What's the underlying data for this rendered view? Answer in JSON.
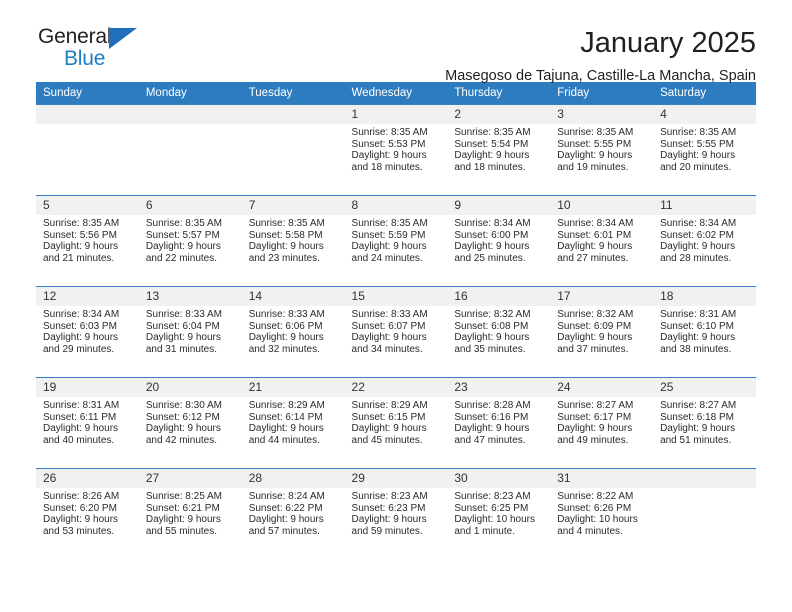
{
  "brand": {
    "name_top": "General",
    "name_bottom": "Blue",
    "triangle_color": "#1f6fba",
    "blue_text_color": "#1f7ec4"
  },
  "header": {
    "title": "January 2025",
    "location": "Masegoso de Tajuna, Castille-La Mancha, Spain"
  },
  "theme": {
    "header_bg": "#2e7cc0",
    "daynum_bg": "#f1f1f1",
    "grid_line": "#2e7cc0"
  },
  "weekdays": [
    "Sunday",
    "Monday",
    "Tuesday",
    "Wednesday",
    "Thursday",
    "Friday",
    "Saturday"
  ],
  "weeks": [
    [
      {
        "day": "",
        "sunrise": "",
        "sunset": "",
        "daylight_1": "",
        "daylight_2": ""
      },
      {
        "day": "",
        "sunrise": "",
        "sunset": "",
        "daylight_1": "",
        "daylight_2": ""
      },
      {
        "day": "",
        "sunrise": "",
        "sunset": "",
        "daylight_1": "",
        "daylight_2": ""
      },
      {
        "day": "1",
        "sunrise": "Sunrise: 8:35 AM",
        "sunset": "Sunset: 5:53 PM",
        "daylight_1": "Daylight: 9 hours",
        "daylight_2": "and 18 minutes."
      },
      {
        "day": "2",
        "sunrise": "Sunrise: 8:35 AM",
        "sunset": "Sunset: 5:54 PM",
        "daylight_1": "Daylight: 9 hours",
        "daylight_2": "and 18 minutes."
      },
      {
        "day": "3",
        "sunrise": "Sunrise: 8:35 AM",
        "sunset": "Sunset: 5:55 PM",
        "daylight_1": "Daylight: 9 hours",
        "daylight_2": "and 19 minutes."
      },
      {
        "day": "4",
        "sunrise": "Sunrise: 8:35 AM",
        "sunset": "Sunset: 5:55 PM",
        "daylight_1": "Daylight: 9 hours",
        "daylight_2": "and 20 minutes."
      }
    ],
    [
      {
        "day": "5",
        "sunrise": "Sunrise: 8:35 AM",
        "sunset": "Sunset: 5:56 PM",
        "daylight_1": "Daylight: 9 hours",
        "daylight_2": "and 21 minutes."
      },
      {
        "day": "6",
        "sunrise": "Sunrise: 8:35 AM",
        "sunset": "Sunset: 5:57 PM",
        "daylight_1": "Daylight: 9 hours",
        "daylight_2": "and 22 minutes."
      },
      {
        "day": "7",
        "sunrise": "Sunrise: 8:35 AM",
        "sunset": "Sunset: 5:58 PM",
        "daylight_1": "Daylight: 9 hours",
        "daylight_2": "and 23 minutes."
      },
      {
        "day": "8",
        "sunrise": "Sunrise: 8:35 AM",
        "sunset": "Sunset: 5:59 PM",
        "daylight_1": "Daylight: 9 hours",
        "daylight_2": "and 24 minutes."
      },
      {
        "day": "9",
        "sunrise": "Sunrise: 8:34 AM",
        "sunset": "Sunset: 6:00 PM",
        "daylight_1": "Daylight: 9 hours",
        "daylight_2": "and 25 minutes."
      },
      {
        "day": "10",
        "sunrise": "Sunrise: 8:34 AM",
        "sunset": "Sunset: 6:01 PM",
        "daylight_1": "Daylight: 9 hours",
        "daylight_2": "and 27 minutes."
      },
      {
        "day": "11",
        "sunrise": "Sunrise: 8:34 AM",
        "sunset": "Sunset: 6:02 PM",
        "daylight_1": "Daylight: 9 hours",
        "daylight_2": "and 28 minutes."
      }
    ],
    [
      {
        "day": "12",
        "sunrise": "Sunrise: 8:34 AM",
        "sunset": "Sunset: 6:03 PM",
        "daylight_1": "Daylight: 9 hours",
        "daylight_2": "and 29 minutes."
      },
      {
        "day": "13",
        "sunrise": "Sunrise: 8:33 AM",
        "sunset": "Sunset: 6:04 PM",
        "daylight_1": "Daylight: 9 hours",
        "daylight_2": "and 31 minutes."
      },
      {
        "day": "14",
        "sunrise": "Sunrise: 8:33 AM",
        "sunset": "Sunset: 6:06 PM",
        "daylight_1": "Daylight: 9 hours",
        "daylight_2": "and 32 minutes."
      },
      {
        "day": "15",
        "sunrise": "Sunrise: 8:33 AM",
        "sunset": "Sunset: 6:07 PM",
        "daylight_1": "Daylight: 9 hours",
        "daylight_2": "and 34 minutes."
      },
      {
        "day": "16",
        "sunrise": "Sunrise: 8:32 AM",
        "sunset": "Sunset: 6:08 PM",
        "daylight_1": "Daylight: 9 hours",
        "daylight_2": "and 35 minutes."
      },
      {
        "day": "17",
        "sunrise": "Sunrise: 8:32 AM",
        "sunset": "Sunset: 6:09 PM",
        "daylight_1": "Daylight: 9 hours",
        "daylight_2": "and 37 minutes."
      },
      {
        "day": "18",
        "sunrise": "Sunrise: 8:31 AM",
        "sunset": "Sunset: 6:10 PM",
        "daylight_1": "Daylight: 9 hours",
        "daylight_2": "and 38 minutes."
      }
    ],
    [
      {
        "day": "19",
        "sunrise": "Sunrise: 8:31 AM",
        "sunset": "Sunset: 6:11 PM",
        "daylight_1": "Daylight: 9 hours",
        "daylight_2": "and 40 minutes."
      },
      {
        "day": "20",
        "sunrise": "Sunrise: 8:30 AM",
        "sunset": "Sunset: 6:12 PM",
        "daylight_1": "Daylight: 9 hours",
        "daylight_2": "and 42 minutes."
      },
      {
        "day": "21",
        "sunrise": "Sunrise: 8:29 AM",
        "sunset": "Sunset: 6:14 PM",
        "daylight_1": "Daylight: 9 hours",
        "daylight_2": "and 44 minutes."
      },
      {
        "day": "22",
        "sunrise": "Sunrise: 8:29 AM",
        "sunset": "Sunset: 6:15 PM",
        "daylight_1": "Daylight: 9 hours",
        "daylight_2": "and 45 minutes."
      },
      {
        "day": "23",
        "sunrise": "Sunrise: 8:28 AM",
        "sunset": "Sunset: 6:16 PM",
        "daylight_1": "Daylight: 9 hours",
        "daylight_2": "and 47 minutes."
      },
      {
        "day": "24",
        "sunrise": "Sunrise: 8:27 AM",
        "sunset": "Sunset: 6:17 PM",
        "daylight_1": "Daylight: 9 hours",
        "daylight_2": "and 49 minutes."
      },
      {
        "day": "25",
        "sunrise": "Sunrise: 8:27 AM",
        "sunset": "Sunset: 6:18 PM",
        "daylight_1": "Daylight: 9 hours",
        "daylight_2": "and 51 minutes."
      }
    ],
    [
      {
        "day": "26",
        "sunrise": "Sunrise: 8:26 AM",
        "sunset": "Sunset: 6:20 PM",
        "daylight_1": "Daylight: 9 hours",
        "daylight_2": "and 53 minutes."
      },
      {
        "day": "27",
        "sunrise": "Sunrise: 8:25 AM",
        "sunset": "Sunset: 6:21 PM",
        "daylight_1": "Daylight: 9 hours",
        "daylight_2": "and 55 minutes."
      },
      {
        "day": "28",
        "sunrise": "Sunrise: 8:24 AM",
        "sunset": "Sunset: 6:22 PM",
        "daylight_1": "Daylight: 9 hours",
        "daylight_2": "and 57 minutes."
      },
      {
        "day": "29",
        "sunrise": "Sunrise: 8:23 AM",
        "sunset": "Sunset: 6:23 PM",
        "daylight_1": "Daylight: 9 hours",
        "daylight_2": "and 59 minutes."
      },
      {
        "day": "30",
        "sunrise": "Sunrise: 8:23 AM",
        "sunset": "Sunset: 6:25 PM",
        "daylight_1": "Daylight: 10 hours",
        "daylight_2": "and 1 minute."
      },
      {
        "day": "31",
        "sunrise": "Sunrise: 8:22 AM",
        "sunset": "Sunset: 6:26 PM",
        "daylight_1": "Daylight: 10 hours",
        "daylight_2": "and 4 minutes."
      },
      {
        "day": "",
        "sunrise": "",
        "sunset": "",
        "daylight_1": "",
        "daylight_2": ""
      }
    ]
  ]
}
